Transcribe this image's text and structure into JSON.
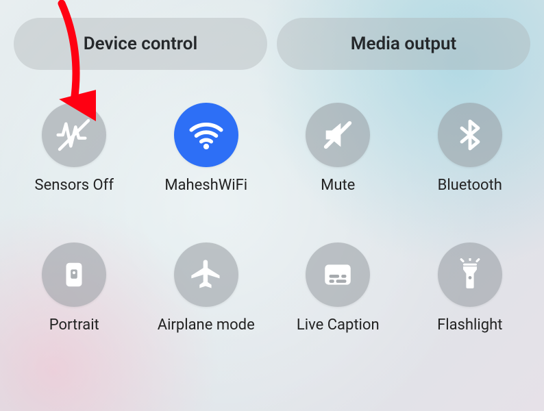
{
  "topbar": {
    "device_control": "Device control",
    "media_output": "Media output"
  },
  "tiles": [
    {
      "id": "sensors-off",
      "label": "Sensors Off",
      "icon": "sensors-off-icon",
      "active": false
    },
    {
      "id": "wifi",
      "label": "MaheshWiFi",
      "icon": "wifi-icon",
      "active": true
    },
    {
      "id": "mute",
      "label": "Mute",
      "icon": "mute-icon",
      "active": false
    },
    {
      "id": "bluetooth",
      "label": "Bluetooth",
      "icon": "bluetooth-icon",
      "active": false
    },
    {
      "id": "portrait",
      "label": "Portrait",
      "icon": "portrait-icon",
      "active": false
    },
    {
      "id": "airplane",
      "label": "Airplane mode",
      "icon": "airplane-icon",
      "active": false
    },
    {
      "id": "live-caption",
      "label": "Live Caption",
      "icon": "caption-icon",
      "active": false
    },
    {
      "id": "flashlight",
      "label": "Flashlight",
      "icon": "flashlight-icon",
      "active": false
    }
  ],
  "annotation": {
    "arrow_color": "#ff0012",
    "points_to": "sensors-off"
  }
}
